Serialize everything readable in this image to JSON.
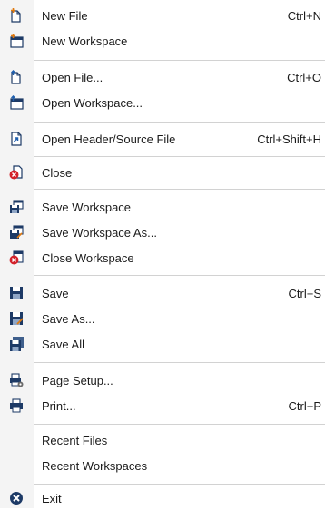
{
  "menu": {
    "new_file": {
      "label": "New File",
      "shortcut": "Ctrl+N",
      "icon": "new-file-icon"
    },
    "new_workspace": {
      "label": "New Workspace",
      "icon": "new-workspace-icon"
    },
    "open_file": {
      "label": "Open File...",
      "shortcut": "Ctrl+O",
      "icon": "open-file-icon"
    },
    "open_workspace": {
      "label": "Open Workspace...",
      "icon": "open-workspace-icon"
    },
    "open_header_source": {
      "label": "Open Header/Source File",
      "shortcut": "Ctrl+Shift+H",
      "icon": "switch-header-source-icon"
    },
    "close": {
      "label": "Close",
      "icon": "close-file-icon"
    },
    "save_workspace": {
      "label": "Save Workspace",
      "icon": "save-workspace-icon"
    },
    "save_workspace_as": {
      "label": "Save Workspace As...",
      "icon": "save-workspace-as-icon"
    },
    "close_workspace": {
      "label": "Close Workspace",
      "icon": "close-workspace-icon"
    },
    "save": {
      "label": "Save",
      "shortcut": "Ctrl+S",
      "icon": "save-icon"
    },
    "save_as": {
      "label": "Save As...",
      "icon": "save-as-icon"
    },
    "save_all": {
      "label": "Save All",
      "icon": "save-all-icon"
    },
    "page_setup": {
      "label": "Page Setup...",
      "icon": "page-setup-icon"
    },
    "print": {
      "label": "Print...",
      "shortcut": "Ctrl+P",
      "icon": "print-icon"
    },
    "recent_files": {
      "label": "Recent Files"
    },
    "recent_workspaces": {
      "label": "Recent Workspaces"
    },
    "exit": {
      "label": "Exit",
      "icon": "exit-icon"
    }
  },
  "colors": {
    "accent_blue": "#1f5fae",
    "navy": "#1d3a66",
    "red": "#d3222a",
    "plus_orange": "#e07a10",
    "separator": "#d2d2d2",
    "gutter": "#f4f4f4"
  }
}
